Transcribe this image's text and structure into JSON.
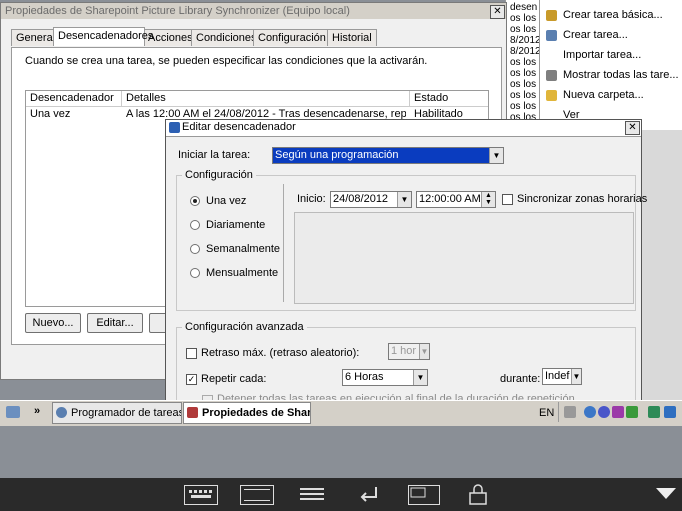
{
  "main_window": {
    "title": "Propiedades de Sharepoint Picture Library Synchronizer (Equipo local)",
    "close_label": "✕",
    "tabs": [
      "General",
      "Desencadenadores",
      "Acciones",
      "Condiciones",
      "Configuración",
      "Historial"
    ],
    "description": "Cuando se crea una tarea, se pueden especificar las condiciones que la activarán.",
    "columns": [
      "Desencadenador",
      "Detalles",
      "Estado"
    ],
    "rows": [
      {
        "trigger": "Una vez",
        "details": "A las 12:00 AM el 24/08/2012 - Tras desencadenarse, repetir c...",
        "status": "Habilitado"
      }
    ],
    "new_button": "Nuevo...",
    "edit_button": "Editar..."
  },
  "background_list": [
    "desen",
    "os los",
    "os los",
    "8/2012",
    "8/2012",
    "os los",
    "os los",
    "os los",
    "os los",
    "os los",
    "os los"
  ],
  "actions_panel": {
    "items": [
      "Crear tarea básica...",
      "Crear tarea...",
      "Importar tarea...",
      "Mostrar todas las tare...",
      "Nueva carpeta...",
      "Ver"
    ]
  },
  "dialog": {
    "title": "Editar desencadenador",
    "start_task_label": "Iniciar la tarea:",
    "start_task_value": "Según una programación",
    "config_group": "Configuración",
    "schedules": [
      "Una vez",
      "Diariamente",
      "Semanalmente",
      "Mensualmente"
    ],
    "selected_schedule": "Una vez",
    "start_label": "Inicio:",
    "start_date": "24/08/2012",
    "start_time": "12:00:00 AM",
    "sync_label": "Sincronizar zonas horarias",
    "advanced_group": "Configuración avanzada",
    "retry_label": "Retraso máx. (retraso aleatorio):",
    "retry_value": "1 hor",
    "repeat_label": "Repetir cada:",
    "repeat_value": "6 Horas",
    "during_label": "durante:",
    "during_value": "Indef",
    "stop_label": "Detener todas las tareas en ejecución al final de la duración de repetición"
  },
  "taskbar": {
    "chevron": "»",
    "tasks": [
      "Programador de tareas",
      "Propiedades de Share..."
    ],
    "lang": "EN"
  },
  "toolbar_icons": [
    "keyboard-icon",
    "screen-icon",
    "menu-icon",
    "enter-icon",
    "window-icon",
    "lock-icon",
    "dropdown-icon"
  ]
}
